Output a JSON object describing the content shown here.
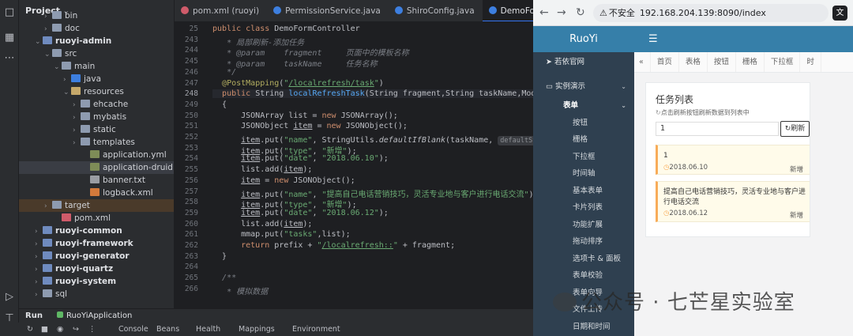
{
  "ide": {
    "project_title": "Project",
    "tree": [
      {
        "label": "bin",
        "icon": "folder-icon",
        "indent": 3,
        "chev": "›"
      },
      {
        "label": "doc",
        "icon": "folder-icon",
        "indent": 3,
        "chev": "›"
      },
      {
        "label": "ruoyi-admin",
        "icon": "module-icon",
        "indent": 2,
        "chev": "⌄",
        "bold": true
      },
      {
        "label": "src",
        "icon": "folder-icon",
        "indent": 3,
        "chev": "⌄"
      },
      {
        "label": "main",
        "icon": "folder-icon",
        "indent": 4,
        "chev": "⌄"
      },
      {
        "label": "java",
        "icon": "java-folder-icon",
        "indent": 5,
        "chev": "›"
      },
      {
        "label": "resources",
        "icon": "resources-folder-icon",
        "indent": 5,
        "chev": "⌄"
      },
      {
        "label": "ehcache",
        "icon": "folder-icon",
        "indent": 6,
        "chev": "›"
      },
      {
        "label": "mybatis",
        "icon": "folder-icon",
        "indent": 6,
        "chev": "›"
      },
      {
        "label": "static",
        "icon": "folder-icon",
        "indent": 6,
        "chev": "›"
      },
      {
        "label": "templates",
        "icon": "folder-icon",
        "indent": 6,
        "chev": "›"
      },
      {
        "label": "application.yml",
        "icon": "yml-file-icon",
        "indent": 7,
        "chev": ""
      },
      {
        "label": "application-druid.yml",
        "icon": "yml-file-icon",
        "indent": 7,
        "chev": "",
        "selected": true
      },
      {
        "label": "banner.txt",
        "icon": "text-file-icon",
        "indent": 7,
        "chev": ""
      },
      {
        "label": "logback.xml",
        "icon": "xml-file-icon",
        "indent": 7,
        "chev": ""
      },
      {
        "label": "target",
        "icon": "folder-icon",
        "indent": 3,
        "chev": "›",
        "target": true
      },
      {
        "label": "pom.xml",
        "icon": "maven-file-icon",
        "indent": 4,
        "chev": ""
      },
      {
        "label": "ruoyi-common",
        "icon": "module-icon",
        "indent": 2,
        "chev": "›",
        "bold": true
      },
      {
        "label": "ruoyi-framework",
        "icon": "module-icon",
        "indent": 2,
        "chev": "›",
        "bold": true
      },
      {
        "label": "ruoyi-generator",
        "icon": "module-icon",
        "indent": 2,
        "chev": "›",
        "bold": true
      },
      {
        "label": "ruoyi-quartz",
        "icon": "module-icon",
        "indent": 2,
        "chev": "›",
        "bold": true
      },
      {
        "label": "ruoyi-system",
        "icon": "module-icon",
        "indent": 2,
        "chev": "›",
        "bold": true
      },
      {
        "label": "sql",
        "icon": "folder-icon",
        "indent": 2,
        "chev": "›"
      }
    ],
    "tabs": [
      {
        "label": "pom.xml (ruoyi)",
        "color": "#cf5b6a"
      },
      {
        "label": "PermissionService.java",
        "color": "#3d7fe0"
      },
      {
        "label": "ShiroConfig.java",
        "color": "#3d7fe0"
      },
      {
        "label": "DemoFormController.java",
        "color": "#3d7fe0",
        "active": true
      }
    ],
    "line_numbers": [
      "25",
      "243",
      "244",
      "245",
      "246",
      "247",
      "248",
      "249",
      "250",
      "251",
      "252",
      "253",
      "254",
      "255",
      "256",
      "257",
      "258",
      "259",
      "260",
      "261",
      "262",
      "263",
      "264",
      "265",
      "266"
    ],
    "code_lines": [
      "<span class='kw'>public class</span> DemoFormController",
      "   <span class='cm'>* 局部刷新-添加任务</span>",
      "   <span class='cm'>* @param    fragment     页面中的模板名称</span>",
      "   <span class='cm'>* @param    taskName     任务名称</span>",
      "   <span class='cm'>*/</span>",
      "  <span class='ann'>@PostMapping</span>(<span class='str'>\"<span class='url'>/localrefresh/task</span>\"</span>)",
      "  <span class='kw'>public</span> String <span class='fn'>localRefreshTask</span>(String fragment,String taskName,ModelMap mmap)",
      "  {",
      "      JSONArray list = <span class='kw'>new</span> JSONArray();",
      "      JSONObject <span class='var'>item</span> = <span class='kw'>new</span> JSONObject();",
      "      <span class='var'>item</span>.put(<span class='str'>\"name\"</span>, StringUtils.<span class='it'>defaultIfBlank</span>(taskName, <span class='hint'>defaultStr:</span> <span class='str'>\"通过电话销售过程中的数据分析\"</span>));",
      "      <span class='var'>item</span>.put(<span class='str'>\"type\"</span>, <span class='str'>\"新增\"</span>);",
      "      <span class='var'>item</span>.put(<span class='str'>\"date\"</span>, <span class='str'>\"2018.06.10\"</span>);",
      "      list.add(<span class='var'>item</span>);",
      "      <span class='var'>item</span> = <span class='kw'>new</span> JSONObject();",
      "      <span class='var'>item</span>.put(<span class='str'>\"name\"</span>, <span class='str'>\"提高自己电话营销技巧，灵活专业地与客户进行电话交流\"</span>);",
      "      <span class='var'>item</span>.put(<span class='str'>\"type\"</span>, <span class='str'>\"新增\"</span>);",
      "      <span class='var'>item</span>.put(<span class='str'>\"date\"</span>, <span class='str'>\"2018.06.12\"</span>);",
      "      list.add(<span class='var'>item</span>);",
      "      mmap.put(<span class='str'>\"tasks\"</span>,list);",
      "      <span class='kw'>return</span> prefix + <span class='str'>\"<span class='url'>/localrefresh::</span>\"</span> + fragment;",
      "  }",
      "",
      "  <span class='cm'>/**</span>",
      "   <span class='cm'>* 模拟数据</span>"
    ],
    "run_label": "Run",
    "run_tab": "RuoYiApplication",
    "tool_items": [
      "Console",
      "Beans",
      "Health",
      "Mappings",
      "Environment"
    ]
  },
  "browser": {
    "url_warning": "不安全",
    "url": "192.168.204.139:8090/index",
    "translate_label": "文"
  },
  "ruoyi": {
    "logo": "RuoYi",
    "menu": [
      {
        "label": "若依官网",
        "kind": "top",
        "icon": "paper-plane-icon"
      },
      {
        "label": "实例演示",
        "kind": "top",
        "icon": "desktop-icon",
        "caret": "⌄"
      },
      {
        "label": "表单",
        "kind": "grp",
        "caret": "⌄"
      },
      {
        "label": "按钮",
        "kind": "sub"
      },
      {
        "label": "栅格",
        "kind": "sub"
      },
      {
        "label": "下拉框",
        "kind": "sub"
      },
      {
        "label": "时间轴",
        "kind": "sub"
      },
      {
        "label": "基本表单",
        "kind": "sub"
      },
      {
        "label": "卡片列表",
        "kind": "sub"
      },
      {
        "label": "功能扩展",
        "kind": "sub"
      },
      {
        "label": "拖动排序",
        "kind": "sub"
      },
      {
        "label": "选项卡 & 面板",
        "kind": "sub"
      },
      {
        "label": "表单校验",
        "kind": "sub"
      },
      {
        "label": "表单向导",
        "kind": "sub"
      },
      {
        "label": "文件上传",
        "kind": "sub"
      },
      {
        "label": "日期和时间",
        "kind": "sub"
      }
    ],
    "tabs": [
      "«",
      "首页",
      "表格",
      "按钮",
      "栅格",
      "下拉框",
      "时"
    ],
    "card_title": "任务列表",
    "card_sub": "点击刷新按钮刷新数据到列表中",
    "input_value": "1",
    "refresh_label": "刷新",
    "tasks": [
      {
        "name": "1",
        "date": "2018.06.10",
        "type": "新增"
      },
      {
        "name": "提高自己电话营销技巧，灵活专业地与客户进行电话交流",
        "date": "2018.06.12",
        "type": "新增"
      }
    ]
  },
  "watermark": "公众号 · 七芒星实验室"
}
